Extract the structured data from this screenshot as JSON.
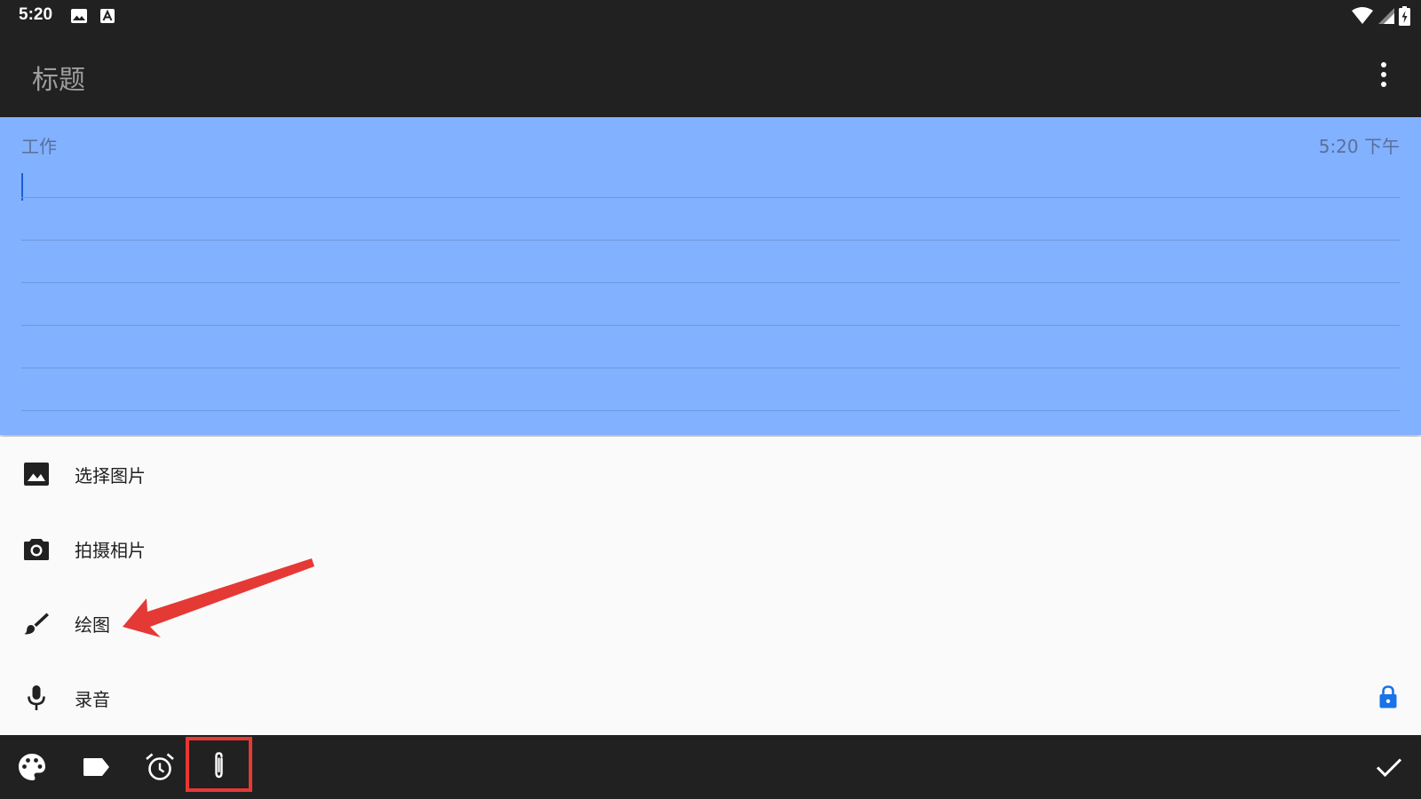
{
  "status_bar": {
    "time": "5:20",
    "notification_icons": [
      "image-icon",
      "font-a-icon"
    ],
    "system_icons": [
      "wifi-icon",
      "signal-icon",
      "battery-charging-icon"
    ]
  },
  "toolbar": {
    "title": "标题",
    "menu_icon": "more-vert-icon"
  },
  "note": {
    "category": "工作",
    "timestamp": "5:20 下午",
    "content": "",
    "background_color": "#82b1ff"
  },
  "attach_sheet": {
    "items": [
      {
        "label": "选择图片",
        "icon": "image-icon"
      },
      {
        "label": "拍摄相片",
        "icon": "camera-icon"
      },
      {
        "label": "绘图",
        "icon": "brush-icon"
      },
      {
        "label": "录音",
        "icon": "mic-icon",
        "locked": true
      }
    ],
    "lock_color": "#1a73e8"
  },
  "bottom_bar": {
    "actions": [
      "palette-icon",
      "label-icon",
      "alarm-icon",
      "attach-icon"
    ],
    "highlighted_action": "attach-icon",
    "confirm_icon": "check-icon"
  },
  "annotation": {
    "arrow_color": "#e53935",
    "highlight_color": "#e53935"
  }
}
